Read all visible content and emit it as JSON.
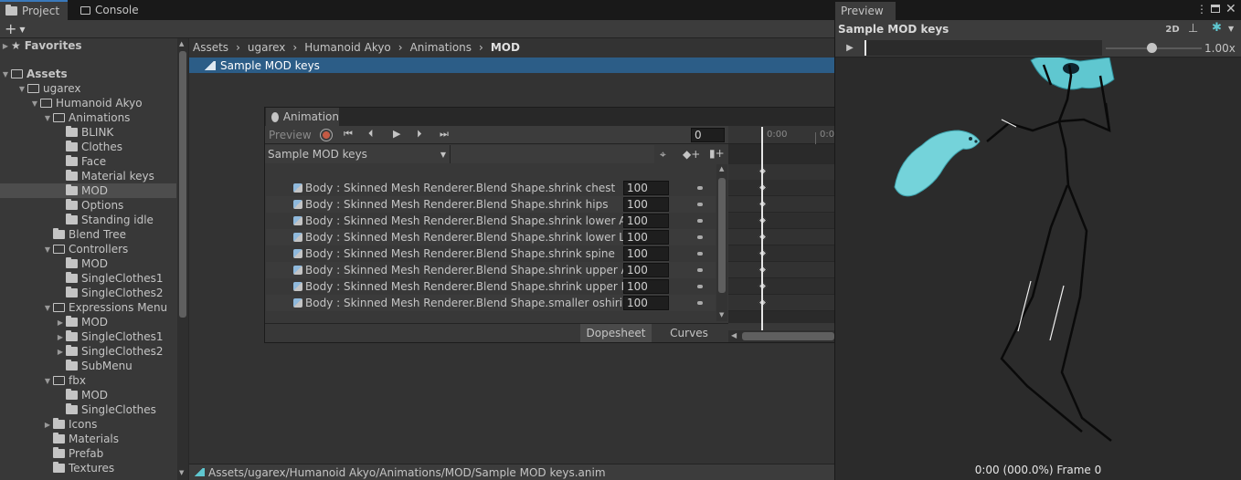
{
  "tabs": {
    "project": "Project",
    "console": "Console"
  },
  "project": {
    "favorites": "Favorites",
    "assets": "Assets",
    "tree": [
      {
        "label": "ugarex",
        "depth": 1,
        "open": true
      },
      {
        "label": "Humanoid Akyo",
        "depth": 2,
        "open": true
      },
      {
        "label": "Animations",
        "depth": 3,
        "open": true
      },
      {
        "label": "BLINK",
        "depth": 4
      },
      {
        "label": "Clothes",
        "depth": 4
      },
      {
        "label": "Face",
        "depth": 4
      },
      {
        "label": "Material keys",
        "depth": 4
      },
      {
        "label": "MOD",
        "depth": 4,
        "selected": true
      },
      {
        "label": "Options",
        "depth": 4
      },
      {
        "label": "Standing idle",
        "depth": 4
      },
      {
        "label": "Blend Tree",
        "depth": 3
      },
      {
        "label": "Controllers",
        "depth": 3,
        "open": true
      },
      {
        "label": "MOD",
        "depth": 4
      },
      {
        "label": "SingleClothes1",
        "depth": 4
      },
      {
        "label": "SingleClothes2",
        "depth": 4
      },
      {
        "label": "Expressions Menu",
        "depth": 3,
        "open": true
      },
      {
        "label": "MOD",
        "depth": 4,
        "closed": true
      },
      {
        "label": "SingleClothes1",
        "depth": 4,
        "closed": true
      },
      {
        "label": "SingleClothes2",
        "depth": 4,
        "closed": true
      },
      {
        "label": "SubMenu",
        "depth": 4
      },
      {
        "label": "fbx",
        "depth": 3,
        "open": true
      },
      {
        "label": "MOD",
        "depth": 4
      },
      {
        "label": "SingleClothes",
        "depth": 4
      },
      {
        "label": "Icons",
        "depth": 3,
        "closed": true
      },
      {
        "label": "Materials",
        "depth": 3
      },
      {
        "label": "Prefab",
        "depth": 3
      },
      {
        "label": "Textures",
        "depth": 3
      }
    ],
    "breadcrumb": [
      "Assets",
      "ugarex",
      "Humanoid Akyo",
      "Animations",
      "MOD"
    ],
    "selected_asset": "Sample MOD keys",
    "status_path": "Assets/ugarex/Humanoid Akyo/Animations/MOD/Sample MOD keys.anim"
  },
  "animation": {
    "title": "Animation",
    "preview_label": "Preview",
    "frame_value": "0",
    "clip_name": "Sample MOD keys",
    "time_label_0": "0:00",
    "time_label_1": "0:0",
    "properties": [
      {
        "label": "Body : Skinned Mesh Renderer.Blend Shape.shrink chest",
        "value": "100"
      },
      {
        "label": "Body : Skinned Mesh Renderer.Blend Shape.shrink hips",
        "value": "100"
      },
      {
        "label": "Body : Skinned Mesh Renderer.Blend Shape.shrink lower Arms",
        "value": "100"
      },
      {
        "label": "Body : Skinned Mesh Renderer.Blend Shape.shrink lower Legs",
        "value": "100"
      },
      {
        "label": "Body : Skinned Mesh Renderer.Blend Shape.shrink spine",
        "value": "100"
      },
      {
        "label": "Body : Skinned Mesh Renderer.Blend Shape.shrink upper Arms",
        "value": "100"
      },
      {
        "label": "Body : Skinned Mesh Renderer.Blend Shape.shrink upper Legs",
        "value": "100"
      },
      {
        "label": "Body : Skinned Mesh Renderer.Blend Shape.smaller oshiri",
        "value": "100"
      }
    ],
    "dopesheet_label": "Dopesheet",
    "curves_label": "Curves"
  },
  "preview": {
    "tab": "Preview",
    "clip_name": "Sample MOD keys",
    "mode_2d": "2D",
    "speed": "1.00x",
    "status": "0:00 (000.0%) Frame 0"
  },
  "colors": {
    "accent": "#3a79bb",
    "selection": "#2c5d87",
    "akyo": "#5fc7d0"
  }
}
